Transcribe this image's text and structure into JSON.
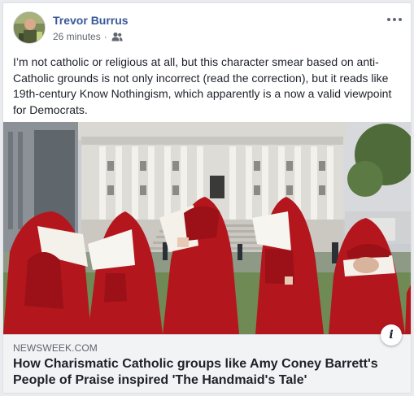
{
  "post": {
    "author": "Trevor Burrus",
    "timestamp": "26 minutes",
    "separator": "·",
    "audience_icon": "friends-icon",
    "text": "I’m not catholic or religious at all, but this character smear based on anti-Catholic grounds is not only incorrect (read the correction), but it reads like 19th-century Know Nothingism, which apparently is a now a valid viewpoint for Democrats."
  },
  "link_preview": {
    "domain": "NEWSWEEK.COM",
    "headline": "How Charismatic Catholic groups like Amy Coney Barrett's People of Praise inspired 'The Handmaid's Tale'",
    "info_label": "i"
  },
  "colors": {
    "author": "#385898",
    "robe": "#b4161d",
    "footer_bg": "#f2f3f5"
  }
}
